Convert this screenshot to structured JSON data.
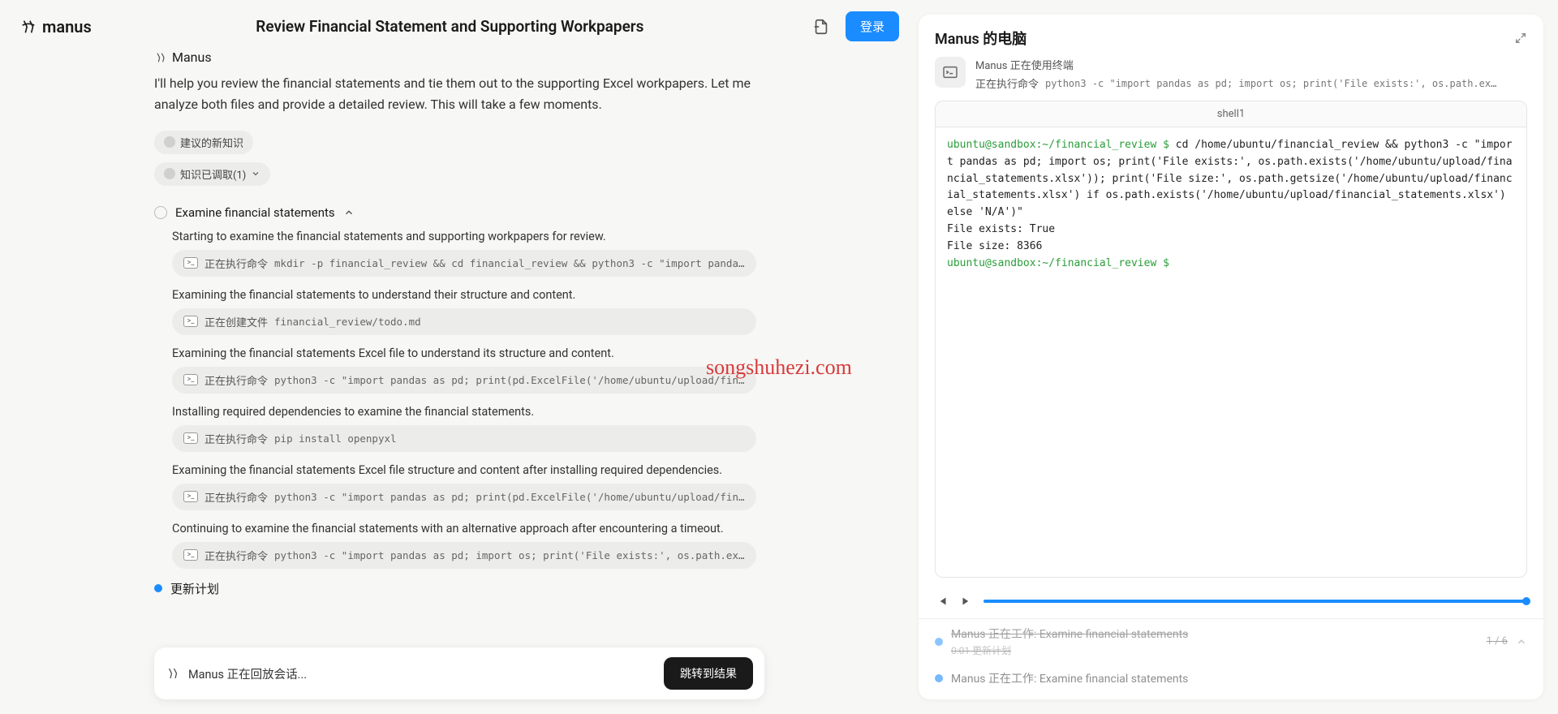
{
  "header": {
    "brand": "manus",
    "title": "Review Financial Statement and Supporting Workpapers",
    "login": "登录"
  },
  "agent": {
    "name": "Manus"
  },
  "intro": "I'll help you review the financial statements and tie them out to the supporting Excel workpapers. Let me analyze both files and provide a detailed review. This will take a few moments.",
  "chips": {
    "suggest": "建议的新知识",
    "retrieved": "知识已调取(1)"
  },
  "task": {
    "title": "Examine financial statements"
  },
  "steps": [
    {
      "text": "Starting to examine the financial statements and supporting workpapers for review.",
      "label": "正在执行命令",
      "code": "mkdir -p financial_review && cd financial_review && python3 -c \"import pandas as pd; pri…"
    },
    {
      "text": "Examining the financial statements to understand their structure and content.",
      "label": "正在创建文件",
      "code": "financial_review/todo.md"
    },
    {
      "text": "Examining the financial statements Excel file to understand its structure and content.",
      "label": "正在执行命令",
      "code": "python3 -c \"import pandas as pd; print(pd.ExcelFile('/home/ubuntu/upload/financial_state…"
    },
    {
      "text": "Installing required dependencies to examine the financial statements.",
      "label": "正在执行命令",
      "code": "pip install openpyxl"
    },
    {
      "text": "Examining the financial statements Excel file structure and content after installing required dependencies.",
      "label": "正在执行命令",
      "code": "python3 -c \"import pandas as pd; print(pd.ExcelFile('/home/ubuntu/upload/financial_state…"
    },
    {
      "text": "Continuing to examine the financial statements with an alternative approach after encountering a timeout.",
      "label": "正在执行命令",
      "code": "python3 -c \"import pandas as pd; import os; print('File exists:', os.path.exists('/home/…"
    }
  ],
  "updatePlan": "更新计划",
  "watermark": "songshuhezi.com",
  "bottomBar": {
    "status": "Manus 正在回放会话...",
    "jump": "跳转到结果"
  },
  "right": {
    "title": "Manus 的电脑",
    "subLine1": "Manus 正在使用终端",
    "subLabel": "正在执行命令",
    "subCode": "python3 -c \"import pandas as pd; import os; print('File exists:', os.path.exists('/ho…",
    "tab": "shell1",
    "prompt1": "ubuntu@sandbox:~/financial_review $",
    "cmd1": " cd /home/ubuntu/financial_review && python3 -c \"import pandas as pd; import os; print('File exists:', os.path.exists('/home/ubuntu/upload/financial_statements.xlsx')); print('File size:', os.path.getsize('/home/ubuntu/upload/financial_statements.xlsx') if os.path.exists('/home/ubuntu/upload/financial_statements.xlsx') else 'N/A')\"",
    "out1": "File exists: True",
    "out2": "File size: 8366",
    "prompt2": "ubuntu@sandbox:~/financial_review $",
    "task1": "Manus 正在工作: Examine financial statements",
    "task1meta": "0:01  更新计划",
    "task2": "Manus 正在工作: Examine financial statements",
    "counter": "1 / 6"
  }
}
